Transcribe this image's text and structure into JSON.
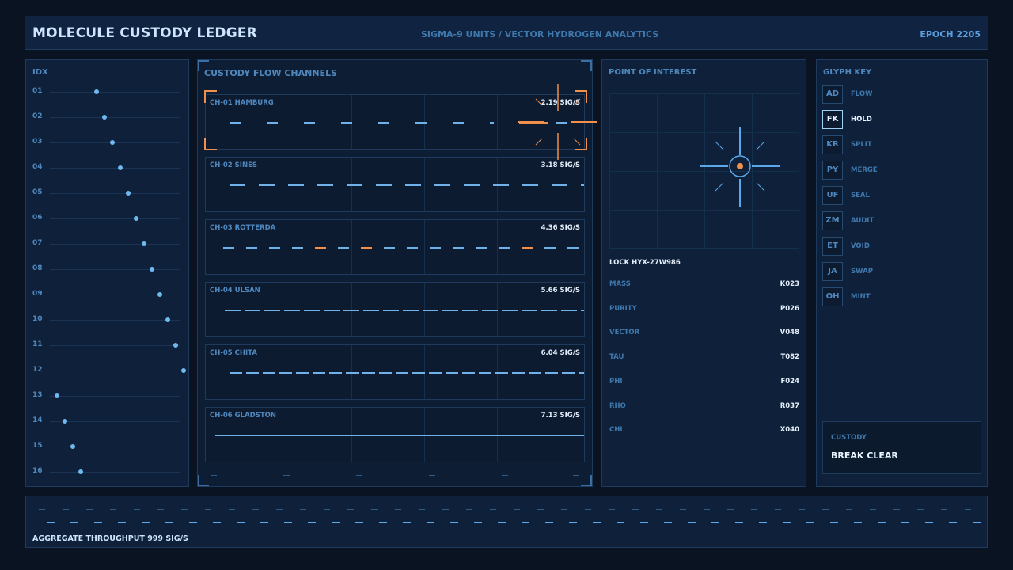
{
  "header": {
    "title": "MOLECULE CUSTODY LEDGER",
    "subtitle": "SIGMA-9 UNITS / VECTOR HYDROGEN ANALYTICS",
    "epoch": "EPOCH 2205"
  },
  "index_panel": {
    "title": "IDX",
    "rows": [
      {
        "label": "01",
        "level": 0.25
      },
      {
        "label": "02",
        "level": 0.3
      },
      {
        "label": "03",
        "level": 0.35
      },
      {
        "label": "04",
        "level": 0.4
      },
      {
        "label": "05",
        "level": 0.45
      },
      {
        "label": "06",
        "level": 0.5
      },
      {
        "label": "07",
        "level": 0.55
      },
      {
        "label": "08",
        "level": 0.6
      },
      {
        "label": "09",
        "level": 0.65
      },
      {
        "label": "10",
        "level": 0.7
      },
      {
        "label": "11",
        "level": 0.75
      },
      {
        "label": "12",
        "level": 0.8
      },
      {
        "label": "13",
        "level": 0.0
      },
      {
        "label": "14",
        "level": 0.05
      },
      {
        "label": "15",
        "level": 0.1
      },
      {
        "label": "16",
        "level": 0.15
      }
    ]
  },
  "flow_panel": {
    "title": "CUSTODY FLOW CHANNELS",
    "channels": [
      {
        "name": "CH-01 HAMBURG",
        "rate": "2.19 SIG/S",
        "selected": true
      },
      {
        "name": "CH-02 SINES",
        "rate": "3.18 SIG/S",
        "selected": false
      },
      {
        "name": "CH-03 ROTTERDA",
        "rate": "4.36 SIG/S",
        "selected": false
      },
      {
        "name": "CH-04 ULSAN",
        "rate": "5.66 SIG/S",
        "selected": false
      },
      {
        "name": "CH-05 CHITA",
        "rate": "6.04 SIG/S",
        "selected": false
      },
      {
        "name": "CH-06 GLADSTON",
        "rate": "7.13 SIG/S",
        "selected": false
      }
    ],
    "accent_color": "#6fb2ea",
    "highlight_color": "#f0904a"
  },
  "poi_panel": {
    "title": "POINT OF INTEREST",
    "lock": "LOCK HYX-27W986",
    "stats": [
      {
        "label": "MASS",
        "value": "K023"
      },
      {
        "label": "PURITY",
        "value": "P026"
      },
      {
        "label": "VECTOR",
        "value": "V048"
      },
      {
        "label": "TAU",
        "value": "T082"
      },
      {
        "label": "PHI",
        "value": "F024"
      },
      {
        "label": "RHO",
        "value": "R037"
      },
      {
        "label": "CHI",
        "value": "X040"
      }
    ]
  },
  "glyph_panel": {
    "title": "GLYPH KEY",
    "items": [
      {
        "code": "AD",
        "label": "FLOW",
        "active": false
      },
      {
        "code": "FK",
        "label": "HOLD",
        "active": true
      },
      {
        "code": "KR",
        "label": "SPLIT",
        "active": false
      },
      {
        "code": "PY",
        "label": "MERGE",
        "active": false
      },
      {
        "code": "UF",
        "label": "SEAL",
        "active": false
      },
      {
        "code": "ZM",
        "label": "AUDIT",
        "active": false
      },
      {
        "code": "ET",
        "label": "VOID",
        "active": false
      },
      {
        "code": "JA",
        "label": "SWAP",
        "active": false
      },
      {
        "code": "OH",
        "label": "MINT",
        "active": false
      }
    ],
    "custody_label": "CUSTODY",
    "custody_status": "BREAK CLEAR"
  },
  "footer": {
    "throughput": "AGGREGATE THROUGHPUT 999 SIG/S"
  }
}
